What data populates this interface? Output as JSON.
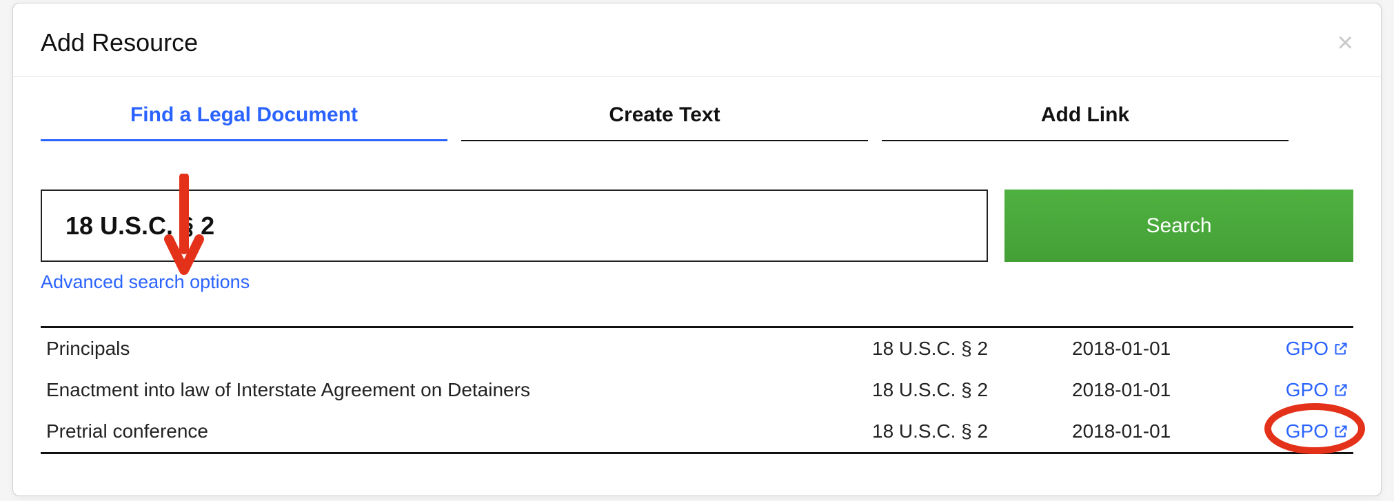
{
  "modal": {
    "title": "Add Resource",
    "close_label": "×"
  },
  "tabs": {
    "find": "Find a Legal Document",
    "create": "Create Text",
    "addlink": "Add Link"
  },
  "search": {
    "value": "18 U.S.C. § 2",
    "button": "Search",
    "advanced": "Advanced search options"
  },
  "results": [
    {
      "title": "Principals",
      "citation": "18 U.S.C. § 2",
      "date": "2018-01-01",
      "source": "GPO"
    },
    {
      "title": "Enactment into law of Interstate Agreement on Detainers",
      "citation": "18 U.S.C. § 2",
      "date": "2018-01-01",
      "source": "GPO"
    },
    {
      "title": "Pretrial conference",
      "citation": "18 U.S.C. § 2",
      "date": "2018-01-01",
      "source": "GPO"
    }
  ]
}
